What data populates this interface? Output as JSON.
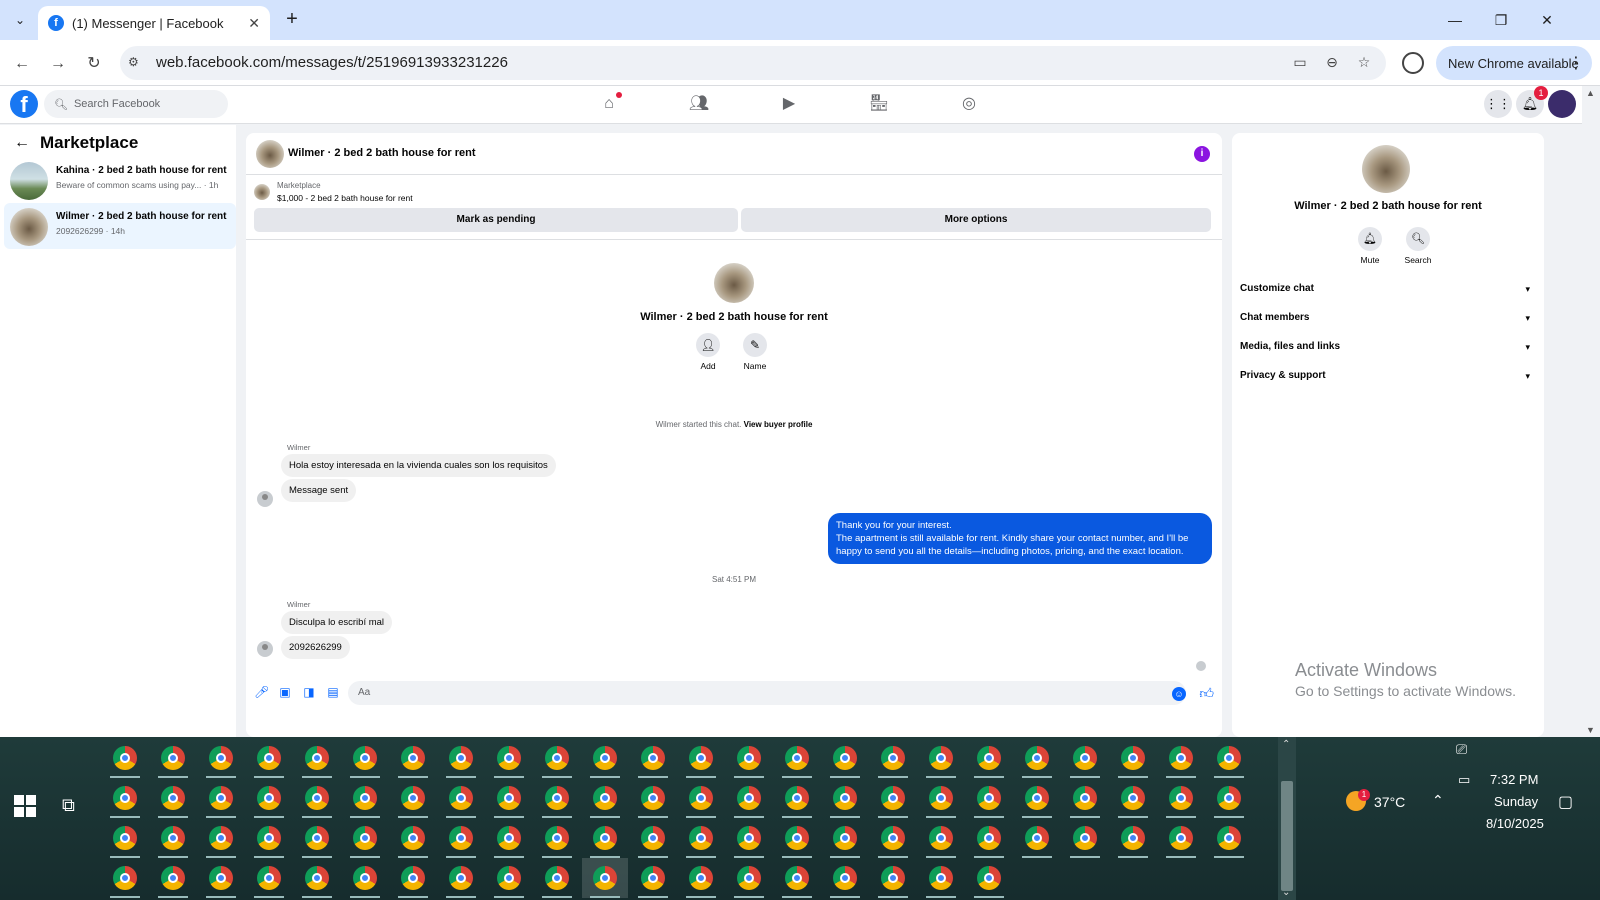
{
  "browser": {
    "tab_title": "(1) Messenger | Facebook",
    "url": "web.facebook.com/messages/t/25196913933231226",
    "new_chrome": "New Chrome available"
  },
  "fb": {
    "search_placeholder": "Search Facebook",
    "notifications_count": "1"
  },
  "left": {
    "title": "Marketplace",
    "conversations": [
      {
        "name": "Kahina · 2 bed 2 bath house for rent",
        "preview": "Beware of common scams using pay... · 1h"
      },
      {
        "name": "Wilmer · 2 bed 2 bath house for rent",
        "preview": "2092626299 · 14h"
      }
    ]
  },
  "chat": {
    "header_name": "Wilmer · 2 bed 2 bath house for rent",
    "marketplace_label": "Marketplace",
    "listing": "$1,000 - 2 bed 2 bath house for rent",
    "mark_pending": "Mark as pending",
    "more_options": "More options",
    "profile_name": "Wilmer · 2 bed 2 bath house for rent",
    "add_label": "Add",
    "name_label": "Name",
    "started_text": "Wilmer started this chat.",
    "view_profile": "View buyer profile",
    "sender": "Wilmer",
    "msg1": "Hola estoy interesada en la vivienda cuales son los requisitos",
    "msg2": "Message sent",
    "out_line1": "Thank you for your interest.",
    "out_line2": "The apartment is still available for rent. Kindly share your contact number, and I'll be happy to send you all the details—including photos, pricing, and the exact location.",
    "timestamp": "Sat 4:51 PM",
    "msg3": "Disculpa lo escribí mal",
    "msg4": "2092626299",
    "composer_placeholder": "Aa"
  },
  "right": {
    "name": "Wilmer · 2 bed 2 bath house for rent",
    "mute": "Mute",
    "search": "Search",
    "sections": [
      "Customize chat",
      "Chat members",
      "Media, files and links",
      "Privacy & support"
    ]
  },
  "watermark": {
    "line1": "Activate Windows",
    "line2": "Go to Settings to activate Windows."
  },
  "taskbar": {
    "temperature": "37°C",
    "weather_badge": "1",
    "time": "7:32 PM",
    "day": "Sunday",
    "date": "8/10/2025"
  },
  "colors": {
    "fb_blue": "#1877f2",
    "outgoing_bubble": "#0a59e0",
    "info_purple": "#8b14e0"
  }
}
